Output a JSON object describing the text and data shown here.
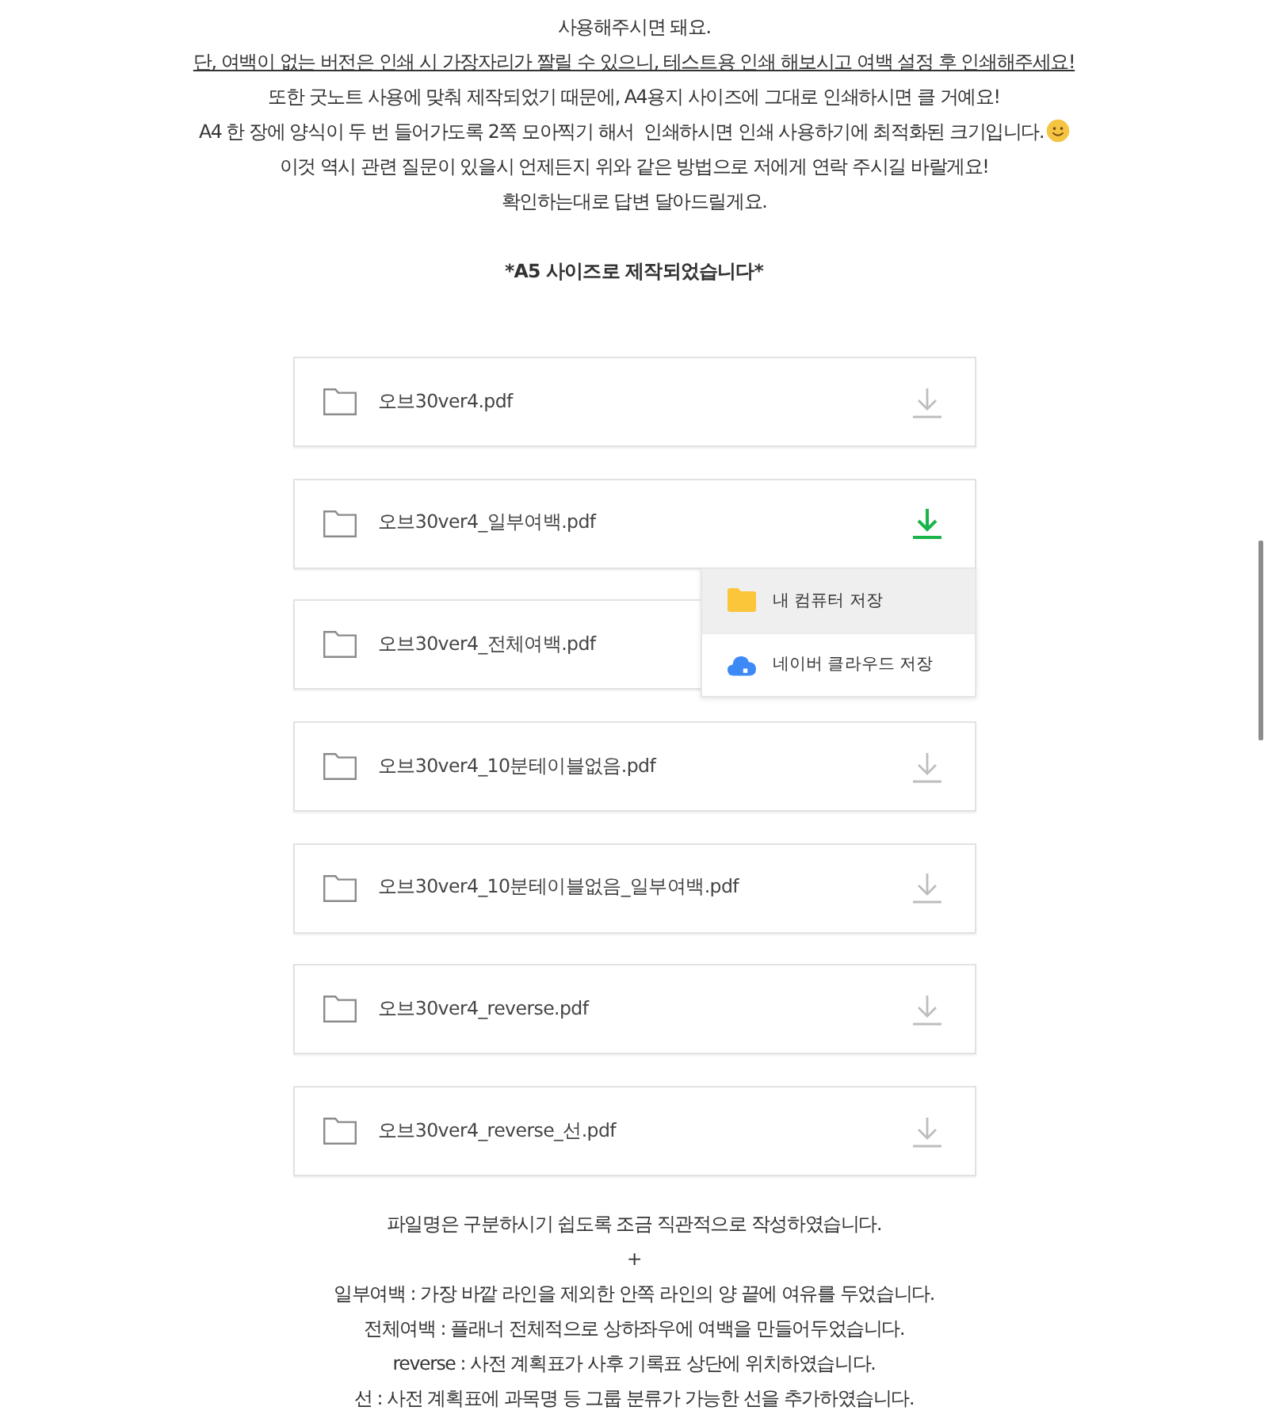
{
  "intro_lines": [
    {
      "text": "사용해주시면 돼요.",
      "underlined": false,
      "emoji": false
    },
    {
      "text": "단, 여백이 없는 버전은 인쇄 시 가장자리가 짤릴 수 있으니, 테스트용 인쇄 해보시고 여백 설정 후 인쇄해주세요!",
      "underlined": true,
      "emoji": false
    },
    {
      "text": "또한 굿노트 사용에 맞춰 제작되었기 때문에, A4용지 사이즈에 그대로 인쇄하시면 클 거예요!",
      "underlined": false,
      "emoji": false
    },
    {
      "text": "A4 한 장에 양식이 두 번 들어가도록 2쪽 모아찍기 해서  인쇄하시면 인쇄 사용하기에 최적화된 크기입니다.",
      "underlined": false,
      "emoji": true
    },
    {
      "text": "이것 역시 관련 질문이 있을시 언제든지 위와 같은 방법으로 저에게 연락 주시길 바랄게요!",
      "underlined": false,
      "emoji": false
    },
    {
      "text": "확인하는대로 답변 달아드릴게요.",
      "underlined": false,
      "emoji": false
    }
  ],
  "notice": "*A5 사이즈로 제작되었습니다*",
  "files": [
    {
      "name": "오브30ver4.pdf",
      "active": false
    },
    {
      "name": "오브30ver4_일부여백.pdf",
      "active": true,
      "menu": {
        "items": [
          {
            "kind": "folder",
            "label": "내 컴퓨터 저장",
            "selected": true
          },
          {
            "kind": "cloud",
            "label": "네이버 클라우드 저장",
            "selected": false
          }
        ]
      }
    },
    {
      "name": "오브30ver4_전체여백.pdf"
    },
    {
      "name": "오브30ver4_10분테이블없음.pdf",
      "active": false
    },
    {
      "name": "오브30ver4_10분테이블없음_일부여백.pdf",
      "active": false
    },
    {
      "name": "오브30ver4_reverse.pdf",
      "active": false
    },
    {
      "name": "오브30ver4_reverse_선.pdf",
      "active": false
    }
  ],
  "notes": [
    "파일명은 구분하시기 쉽도록 조금 직관적으로 작성하였습니다.",
    "+",
    "일부여백 : 가장 바깥 라인을 제외한 안쪽 라인의 양 끝에 여유를 두었습니다.",
    "전체여백 : 플래너 전체적으로 상하좌우에 여백을 만들어두었습니다.",
    "reverse : 사전 계획표가 사후 기록표 상단에 위치하였습니다.",
    "선 : 사전 계획표에 과목명 등 그룹 분류가 가능한 선을 추가하였습니다."
  ]
}
